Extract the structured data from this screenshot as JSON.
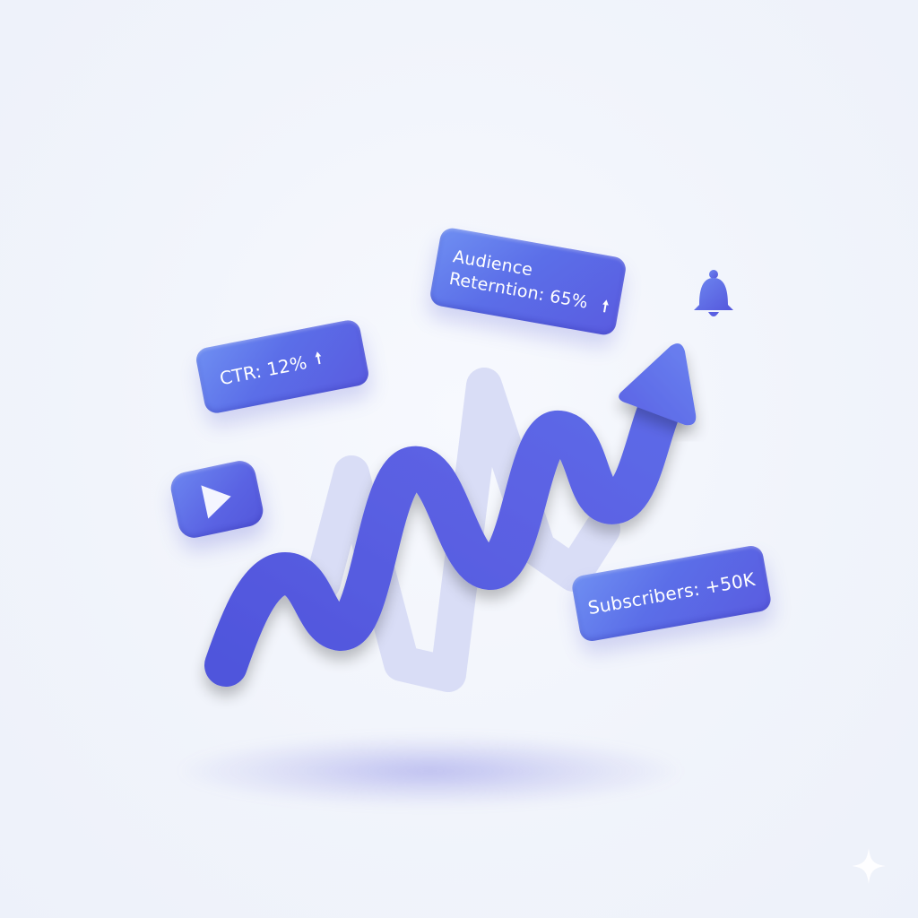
{
  "badges": {
    "ctr": {
      "label": "CTR: 12%",
      "trend_icon": "arrow-up-icon"
    },
    "retention": {
      "line1": "Audience",
      "line2": "Reterntion: 65%",
      "trend_icon": "arrow-up-icon"
    },
    "subscribers": {
      "label": "Subscribers: +50K"
    }
  },
  "icons": {
    "play": "play-icon",
    "bell": "bell-icon",
    "growth_arrow": "growth-arrow-icon",
    "sparkle": "sparkle-icon"
  },
  "glyphs": {
    "up_arrow": "🠕"
  },
  "colors": {
    "background": "#f1f4fb",
    "primary": "#5a5ce0",
    "primary_light": "#6f8ff2",
    "ghost_line": "#cdd3f4",
    "label_text": "#ffffff"
  }
}
